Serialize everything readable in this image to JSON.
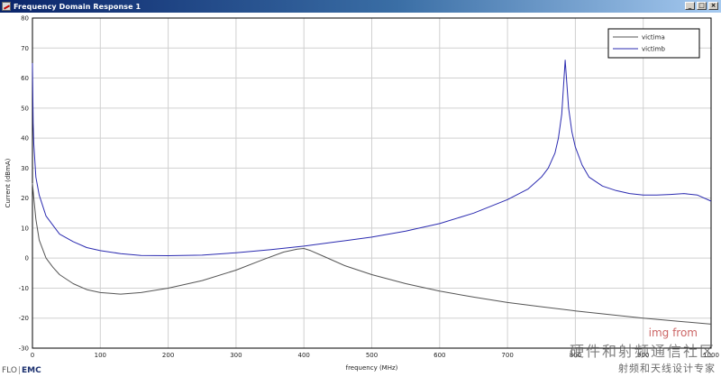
{
  "window": {
    "title": "Frequency Domain Response 1",
    "controls": [
      "minimize",
      "maximize",
      "close"
    ]
  },
  "chart_data": {
    "type": "line",
    "title": "",
    "xlabel": "frequency (MHz)",
    "ylabel": "Current (dBmA)",
    "xlim": [
      0,
      1000
    ],
    "ylim": [
      -30,
      80
    ],
    "xticks": [
      0,
      100,
      200,
      300,
      400,
      500,
      600,
      700,
      800,
      900,
      1000
    ],
    "yticks": [
      -30,
      -20,
      -10,
      0,
      10,
      20,
      30,
      40,
      50,
      60,
      70,
      80
    ],
    "grid": true,
    "legend_position": "top-right",
    "series": [
      {
        "name": "victima",
        "color": "#555555",
        "x": [
          0,
          2,
          5,
          10,
          20,
          30,
          40,
          60,
          80,
          100,
          130,
          160,
          200,
          250,
          300,
          340,
          370,
          390,
          400,
          410,
          430,
          460,
          500,
          550,
          600,
          650,
          700,
          750,
          800,
          850,
          900,
          950,
          1000
        ],
        "y": [
          25,
          20,
          13,
          6,
          0,
          -3,
          -5.5,
          -8.5,
          -10.5,
          -11.5,
          -12,
          -11.5,
          -10,
          -7.5,
          -4,
          -0.5,
          2,
          3,
          3.2,
          2.5,
          0.5,
          -2.5,
          -5.5,
          -8.5,
          -11,
          -13,
          -14.8,
          -16.2,
          -17.6,
          -18.8,
          -20,
          -21,
          -22
        ]
      },
      {
        "name": "victimb",
        "color": "#2b2bb0",
        "x": [
          0,
          1,
          2,
          5,
          10,
          20,
          40,
          60,
          80,
          100,
          130,
          160,
          200,
          250,
          300,
          350,
          400,
          450,
          500,
          550,
          600,
          650,
          700,
          730,
          750,
          760,
          770,
          775,
          780,
          785,
          790,
          795,
          800,
          810,
          820,
          840,
          860,
          880,
          900,
          920,
          940,
          960,
          980,
          1000
        ],
        "y": [
          65,
          45,
          38,
          27,
          21,
          14,
          8,
          5.5,
          3.5,
          2.5,
          1.5,
          0.9,
          0.8,
          1,
          1.8,
          2.8,
          4,
          5.5,
          7,
          9,
          11.5,
          15,
          19.5,
          23,
          27,
          30,
          35,
          40,
          48,
          66,
          50,
          42,
          37,
          31,
          27,
          24,
          22.5,
          21.5,
          21,
          21,
          21.2,
          21.5,
          21,
          19
        ]
      }
    ]
  },
  "logo": {
    "left": "FLO",
    "separator": "|",
    "right": "EMC"
  },
  "watermark": {
    "line1": "img from",
    "line2": "硬件和射频通信社区",
    "line3": "射频和天线设计专家"
  }
}
